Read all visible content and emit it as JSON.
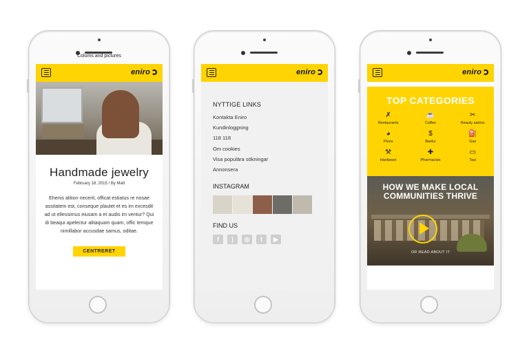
{
  "phone1": {
    "caption": "Colums and pictures",
    "brand": "eniro",
    "title": "Handmade jewelry",
    "meta": "February 18, 2015 / By Matt",
    "body": "Ehenis alition necerit, officat estiatus re nosae assitatem est, conseque plautet et es im excesdit ad ut ellessimus eiusam a et audis im ventur? Qui di beaqui apelectur alitaquam quam, offic temque nimillabor accusdae samus, oditae.",
    "button": "CENTRERET"
  },
  "phone2": {
    "brand": "eniro",
    "links_heading": "NYTTIGE LINKS",
    "links": [
      "Kontakta Eniro",
      "Kundinloggning",
      "118 118",
      "Om cookies",
      "Visa populära sökningar",
      "Annonsera"
    ],
    "instagram_heading": "INSTAGRAM",
    "instagram_colors": [
      "#d9d4c8",
      "#e6e2d8",
      "#8d5f4a",
      "#6d6c66",
      "#bfb9ae",
      "#c9a489"
    ],
    "findus_heading": "FIND US",
    "social_icons": [
      "facebook-icon",
      "rss-icon",
      "instagram-icon",
      "twitter-icon",
      "youtube-icon"
    ]
  },
  "phone3": {
    "brand": "eniro",
    "categories_title": "TOP CATEGORIES",
    "categories": [
      {
        "label": "Restaurants",
        "icon": "✗"
      },
      {
        "label": "Coffee",
        "icon": "☕"
      },
      {
        "label": "Beauty salons",
        "icon": "✂"
      },
      {
        "label": "Pizza",
        "icon": "◕"
      },
      {
        "label": "Banks",
        "icon": "$"
      },
      {
        "label": "Gas",
        "icon": "⛽"
      },
      {
        "label": "Hardware",
        "icon": "⚒"
      },
      {
        "label": "Pharmacies",
        "icon": "✚"
      },
      {
        "label": "Taxi",
        "icon": "▭"
      }
    ],
    "video_title": "HOW WE MAKE LOCAL COMMUNITIES THRIVE",
    "video_link": "OR READ ABOUT IT"
  },
  "colors": {
    "accent": "#ffd400"
  }
}
